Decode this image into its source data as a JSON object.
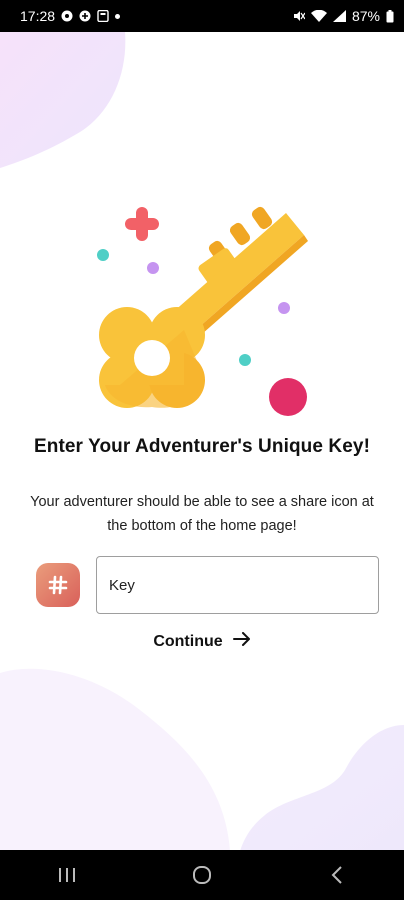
{
  "status_bar": {
    "time": "17:28",
    "battery": "87%"
  },
  "content": {
    "title": "Enter Your Adventurer's Unique Key!",
    "description": "Your adventurer should be able to see a share icon at the bottom of the home page!",
    "key_input": {
      "placeholder": "Key",
      "value": ""
    },
    "continue_label": "Continue"
  },
  "icons": {
    "hash": "hash-icon",
    "arrow": "arrow-right-icon",
    "hero": "key-icon"
  },
  "colors": {
    "key_gold": "#f9c33a",
    "key_shadow": "#f0a623",
    "cross_red": "#f26167",
    "dot_teal": "#4fcfc6",
    "dot_purple": "#c594f0",
    "big_dot_pink": "#e12f67",
    "badge_gradient": [
      "#ea9d7c",
      "#d9605a"
    ],
    "blob_lavender": "#f1e7fb"
  }
}
